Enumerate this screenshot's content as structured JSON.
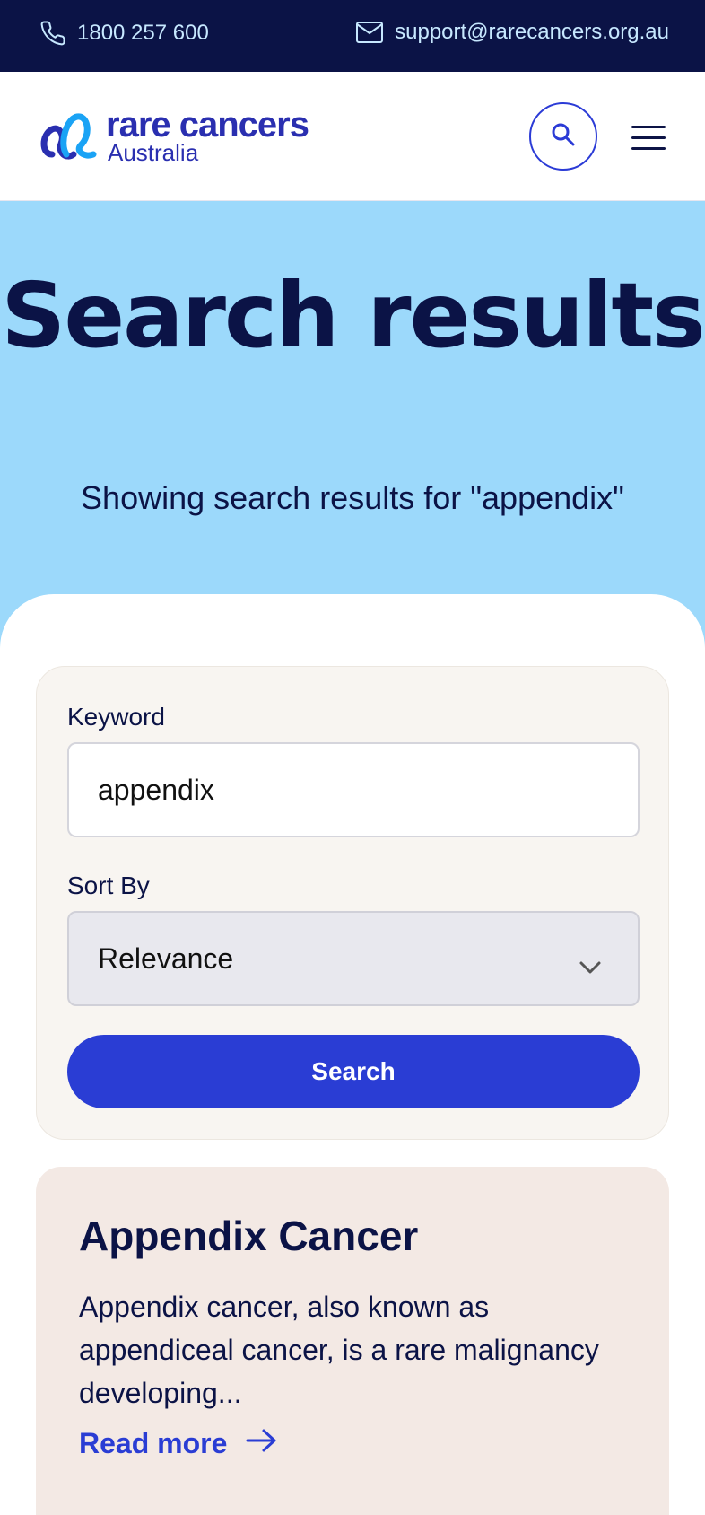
{
  "topbar": {
    "phone": "1800 257 600",
    "email": "support@rarecancers.org.au"
  },
  "header": {
    "logo_line1": "rare cancers",
    "logo_line2": "Australia"
  },
  "hero": {
    "title": "Search results",
    "subtitle": "Showing search results for \"appendix\""
  },
  "search_form": {
    "keyword_label": "Keyword",
    "keyword_value": "appendix",
    "sort_label": "Sort By",
    "sort_value": "Relevance",
    "submit_label": "Search"
  },
  "results": [
    {
      "title": "Appendix Cancer",
      "excerpt": "Appendix cancer, also known as appendiceal cancer, is a rare malignancy developing...",
      "link_label": "Read more"
    }
  ],
  "colors": {
    "navy": "#0b1346",
    "hero_bg": "#9cd9fb",
    "accent_blue": "#2a3dd4",
    "card_bg": "#f8f5f1",
    "result_bg": "#f3e9e4"
  }
}
